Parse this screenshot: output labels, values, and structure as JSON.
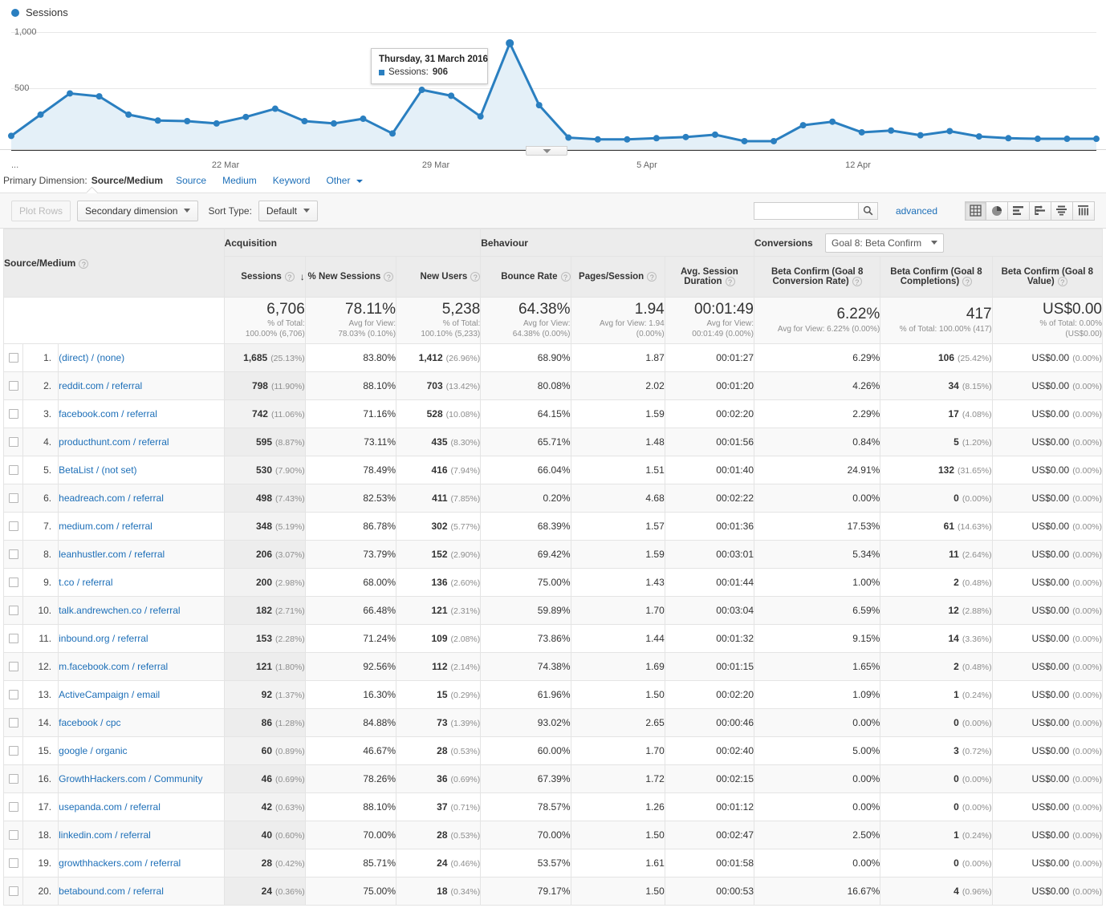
{
  "chart": {
    "legend_label": "Sessions",
    "y_ticks": [
      "1,000",
      "500"
    ],
    "x_ticks": [
      "22 Mar",
      "29 Mar",
      "5 Apr",
      "12 Apr"
    ],
    "x_leading_ellipsis": "...",
    "tooltip": {
      "date": "Thursday, 31 March 2016",
      "metric_label": "Sessions:",
      "metric_value": "906"
    },
    "line_color": "#2a7fc0",
    "fill_color": "#e4f0f8"
  },
  "chart_data": {
    "type": "line",
    "title": "Sessions",
    "xlabel": "",
    "ylabel": "Sessions",
    "ylim": [
      0,
      1000
    ],
    "grid": true,
    "legend": [
      "Sessions"
    ],
    "tick_labels_x": [
      "22 Mar",
      "29 Mar",
      "5 Apr",
      "12 Apr"
    ],
    "tick_labels_y": [
      "500",
      "1,000"
    ],
    "annotation": "Thursday, 31 March 2016 — Sessions: 906",
    "series": [
      {
        "name": "Sessions",
        "values": [
          120,
          300,
          480,
          455,
          300,
          250,
          245,
          225,
          280,
          350,
          245,
          225,
          265,
          140,
          510,
          460,
          285,
          906,
          380,
          105,
          90,
          90,
          100,
          110,
          130,
          75,
          75,
          210,
          240,
          150,
          165,
          125,
          160,
          115,
          100,
          95,
          95,
          95
        ]
      }
    ]
  },
  "primary_dimension": {
    "label": "Primary Dimension:",
    "current": "Source/Medium",
    "links": [
      "Source",
      "Medium",
      "Keyword"
    ],
    "other": "Other"
  },
  "toolbar": {
    "plot_rows": "Plot Rows",
    "secondary_dimension": "Secondary dimension",
    "sort_type_label": "Sort Type:",
    "sort_type_value": "Default",
    "search_value": "",
    "search_placeholder": "",
    "advanced": "advanced",
    "view_icons": [
      "table-view-icon",
      "pie-view-icon",
      "bar-view-icon",
      "comparison-view-icon",
      "pivot-view-icon",
      "performance-view-icon"
    ]
  },
  "table": {
    "groups": {
      "dimension": "Source/Medium",
      "acquisition": "Acquisition",
      "behaviour": "Behaviour",
      "conversions": "Conversions",
      "conversions_select": "Goal 8: Beta Confirm"
    },
    "columns": [
      "Sessions",
      "% New Sessions",
      "New Users",
      "Bounce Rate",
      "Pages/Session",
      "Avg. Session Duration",
      "Beta Confirm (Goal 8 Conversion Rate)",
      "Beta Confirm (Goal 8 Completions)",
      "Beta Confirm (Goal 8 Value)"
    ],
    "sort_column": "Sessions",
    "sort_direction": "desc",
    "totals": [
      {
        "big": "6,706",
        "sub1": "% of Total:",
        "sub2": "100.00% (6,706)"
      },
      {
        "big": "78.11%",
        "sub1": "Avg for View:",
        "sub2": "78.03% (0.10%)"
      },
      {
        "big": "5,238",
        "sub1": "% of Total:",
        "sub2": "100.10% (5,233)"
      },
      {
        "big": "64.38%",
        "sub1": "Avg for View:",
        "sub2": "64.38% (0.00%)"
      },
      {
        "big": "1.94",
        "sub1": "Avg for View: 1.94",
        "sub2": "(0.00%)"
      },
      {
        "big": "00:01:49",
        "sub1": "Avg for View:",
        "sub2": "00:01:49 (0.00%)"
      },
      {
        "big": "6.22%",
        "sub1": "Avg for View: 6.22% (0.00%)",
        "sub2": ""
      },
      {
        "big": "417",
        "sub1": "% of Total: 100.00% (417)",
        "sub2": ""
      },
      {
        "big": "US$0.00",
        "sub1": "% of Total: 0.00%",
        "sub2": "(US$0.00)"
      }
    ],
    "rows": [
      {
        "index": "1.",
        "source": "(direct) / (none)",
        "sessions": "1,685",
        "sessions_pct": "(25.13%)",
        "new_sessions_pct": "83.80%",
        "new_users": "1,412",
        "new_users_pct": "(26.96%)",
        "bounce_rate": "68.90%",
        "pages_session": "1.87",
        "avg_duration": "00:01:27",
        "goal_rate": "6.29%",
        "goal_completions": "106",
        "goal_completions_pct": "(25.42%)",
        "goal_value": "US$0.00",
        "goal_value_pct": "(0.00%)"
      },
      {
        "index": "2.",
        "source": "reddit.com / referral",
        "sessions": "798",
        "sessions_pct": "(11.90%)",
        "new_sessions_pct": "88.10%",
        "new_users": "703",
        "new_users_pct": "(13.42%)",
        "bounce_rate": "80.08%",
        "pages_session": "2.02",
        "avg_duration": "00:01:20",
        "goal_rate": "4.26%",
        "goal_completions": "34",
        "goal_completions_pct": "(8.15%)",
        "goal_value": "US$0.00",
        "goal_value_pct": "(0.00%)"
      },
      {
        "index": "3.",
        "source": "facebook.com / referral",
        "sessions": "742",
        "sessions_pct": "(11.06%)",
        "new_sessions_pct": "71.16%",
        "new_users": "528",
        "new_users_pct": "(10.08%)",
        "bounce_rate": "64.15%",
        "pages_session": "1.59",
        "avg_duration": "00:02:20",
        "goal_rate": "2.29%",
        "goal_completions": "17",
        "goal_completions_pct": "(4.08%)",
        "goal_value": "US$0.00",
        "goal_value_pct": "(0.00%)"
      },
      {
        "index": "4.",
        "source": "producthunt.com / referral",
        "sessions": "595",
        "sessions_pct": "(8.87%)",
        "new_sessions_pct": "73.11%",
        "new_users": "435",
        "new_users_pct": "(8.30%)",
        "bounce_rate": "65.71%",
        "pages_session": "1.48",
        "avg_duration": "00:01:56",
        "goal_rate": "0.84%",
        "goal_completions": "5",
        "goal_completions_pct": "(1.20%)",
        "goal_value": "US$0.00",
        "goal_value_pct": "(0.00%)"
      },
      {
        "index": "5.",
        "source": "BetaList / (not set)",
        "sessions": "530",
        "sessions_pct": "(7.90%)",
        "new_sessions_pct": "78.49%",
        "new_users": "416",
        "new_users_pct": "(7.94%)",
        "bounce_rate": "66.04%",
        "pages_session": "1.51",
        "avg_duration": "00:01:40",
        "goal_rate": "24.91%",
        "goal_completions": "132",
        "goal_completions_pct": "(31.65%)",
        "goal_value": "US$0.00",
        "goal_value_pct": "(0.00%)"
      },
      {
        "index": "6.",
        "source": "headreach.com / referral",
        "sessions": "498",
        "sessions_pct": "(7.43%)",
        "new_sessions_pct": "82.53%",
        "new_users": "411",
        "new_users_pct": "(7.85%)",
        "bounce_rate": "0.20%",
        "pages_session": "4.68",
        "avg_duration": "00:02:22",
        "goal_rate": "0.00%",
        "goal_completions": "0",
        "goal_completions_pct": "(0.00%)",
        "goal_value": "US$0.00",
        "goal_value_pct": "(0.00%)"
      },
      {
        "index": "7.",
        "source": "medium.com / referral",
        "sessions": "348",
        "sessions_pct": "(5.19%)",
        "new_sessions_pct": "86.78%",
        "new_users": "302",
        "new_users_pct": "(5.77%)",
        "bounce_rate": "68.39%",
        "pages_session": "1.57",
        "avg_duration": "00:01:36",
        "goal_rate": "17.53%",
        "goal_completions": "61",
        "goal_completions_pct": "(14.63%)",
        "goal_value": "US$0.00",
        "goal_value_pct": "(0.00%)"
      },
      {
        "index": "8.",
        "source": "leanhustler.com / referral",
        "sessions": "206",
        "sessions_pct": "(3.07%)",
        "new_sessions_pct": "73.79%",
        "new_users": "152",
        "new_users_pct": "(2.90%)",
        "bounce_rate": "69.42%",
        "pages_session": "1.59",
        "avg_duration": "00:03:01",
        "goal_rate": "5.34%",
        "goal_completions": "11",
        "goal_completions_pct": "(2.64%)",
        "goal_value": "US$0.00",
        "goal_value_pct": "(0.00%)"
      },
      {
        "index": "9.",
        "source": "t.co / referral",
        "sessions": "200",
        "sessions_pct": "(2.98%)",
        "new_sessions_pct": "68.00%",
        "new_users": "136",
        "new_users_pct": "(2.60%)",
        "bounce_rate": "75.00%",
        "pages_session": "1.43",
        "avg_duration": "00:01:44",
        "goal_rate": "1.00%",
        "goal_completions": "2",
        "goal_completions_pct": "(0.48%)",
        "goal_value": "US$0.00",
        "goal_value_pct": "(0.00%)"
      },
      {
        "index": "10.",
        "source": "talk.andrewchen.co / referral",
        "sessions": "182",
        "sessions_pct": "(2.71%)",
        "new_sessions_pct": "66.48%",
        "new_users": "121",
        "new_users_pct": "(2.31%)",
        "bounce_rate": "59.89%",
        "pages_session": "1.70",
        "avg_duration": "00:03:04",
        "goal_rate": "6.59%",
        "goal_completions": "12",
        "goal_completions_pct": "(2.88%)",
        "goal_value": "US$0.00",
        "goal_value_pct": "(0.00%)"
      },
      {
        "index": "11.",
        "source": "inbound.org / referral",
        "sessions": "153",
        "sessions_pct": "(2.28%)",
        "new_sessions_pct": "71.24%",
        "new_users": "109",
        "new_users_pct": "(2.08%)",
        "bounce_rate": "73.86%",
        "pages_session": "1.44",
        "avg_duration": "00:01:32",
        "goal_rate": "9.15%",
        "goal_completions": "14",
        "goal_completions_pct": "(3.36%)",
        "goal_value": "US$0.00",
        "goal_value_pct": "(0.00%)"
      },
      {
        "index": "12.",
        "source": "m.facebook.com / referral",
        "sessions": "121",
        "sessions_pct": "(1.80%)",
        "new_sessions_pct": "92.56%",
        "new_users": "112",
        "new_users_pct": "(2.14%)",
        "bounce_rate": "74.38%",
        "pages_session": "1.69",
        "avg_duration": "00:01:15",
        "goal_rate": "1.65%",
        "goal_completions": "2",
        "goal_completions_pct": "(0.48%)",
        "goal_value": "US$0.00",
        "goal_value_pct": "(0.00%)"
      },
      {
        "index": "13.",
        "source": "ActiveCampaign / email",
        "sessions": "92",
        "sessions_pct": "(1.37%)",
        "new_sessions_pct": "16.30%",
        "new_users": "15",
        "new_users_pct": "(0.29%)",
        "bounce_rate": "61.96%",
        "pages_session": "1.50",
        "avg_duration": "00:02:20",
        "goal_rate": "1.09%",
        "goal_completions": "1",
        "goal_completions_pct": "(0.24%)",
        "goal_value": "US$0.00",
        "goal_value_pct": "(0.00%)"
      },
      {
        "index": "14.",
        "source": "facebook / cpc",
        "sessions": "86",
        "sessions_pct": "(1.28%)",
        "new_sessions_pct": "84.88%",
        "new_users": "73",
        "new_users_pct": "(1.39%)",
        "bounce_rate": "93.02%",
        "pages_session": "2.65",
        "avg_duration": "00:00:46",
        "goal_rate": "0.00%",
        "goal_completions": "0",
        "goal_completions_pct": "(0.00%)",
        "goal_value": "US$0.00",
        "goal_value_pct": "(0.00%)"
      },
      {
        "index": "15.",
        "source": "google / organic",
        "sessions": "60",
        "sessions_pct": "(0.89%)",
        "new_sessions_pct": "46.67%",
        "new_users": "28",
        "new_users_pct": "(0.53%)",
        "bounce_rate": "60.00%",
        "pages_session": "1.70",
        "avg_duration": "00:02:40",
        "goal_rate": "5.00%",
        "goal_completions": "3",
        "goal_completions_pct": "(0.72%)",
        "goal_value": "US$0.00",
        "goal_value_pct": "(0.00%)"
      },
      {
        "index": "16.",
        "source": "GrowthHackers.com / Community",
        "sessions": "46",
        "sessions_pct": "(0.69%)",
        "new_sessions_pct": "78.26%",
        "new_users": "36",
        "new_users_pct": "(0.69%)",
        "bounce_rate": "67.39%",
        "pages_session": "1.72",
        "avg_duration": "00:02:15",
        "goal_rate": "0.00%",
        "goal_completions": "0",
        "goal_completions_pct": "(0.00%)",
        "goal_value": "US$0.00",
        "goal_value_pct": "(0.00%)"
      },
      {
        "index": "17.",
        "source": "usepanda.com / referral",
        "sessions": "42",
        "sessions_pct": "(0.63%)",
        "new_sessions_pct": "88.10%",
        "new_users": "37",
        "new_users_pct": "(0.71%)",
        "bounce_rate": "78.57%",
        "pages_session": "1.26",
        "avg_duration": "00:01:12",
        "goal_rate": "0.00%",
        "goal_completions": "0",
        "goal_completions_pct": "(0.00%)",
        "goal_value": "US$0.00",
        "goal_value_pct": "(0.00%)"
      },
      {
        "index": "18.",
        "source": "linkedin.com / referral",
        "sessions": "40",
        "sessions_pct": "(0.60%)",
        "new_sessions_pct": "70.00%",
        "new_users": "28",
        "new_users_pct": "(0.53%)",
        "bounce_rate": "70.00%",
        "pages_session": "1.50",
        "avg_duration": "00:02:47",
        "goal_rate": "2.50%",
        "goal_completions": "1",
        "goal_completions_pct": "(0.24%)",
        "goal_value": "US$0.00",
        "goal_value_pct": "(0.00%)"
      },
      {
        "index": "19.",
        "source": "growthhackers.com / referral",
        "sessions": "28",
        "sessions_pct": "(0.42%)",
        "new_sessions_pct": "85.71%",
        "new_users": "24",
        "new_users_pct": "(0.46%)",
        "bounce_rate": "53.57%",
        "pages_session": "1.61",
        "avg_duration": "00:01:58",
        "goal_rate": "0.00%",
        "goal_completions": "0",
        "goal_completions_pct": "(0.00%)",
        "goal_value": "US$0.00",
        "goal_value_pct": "(0.00%)"
      },
      {
        "index": "20.",
        "source": "betabound.com / referral",
        "sessions": "24",
        "sessions_pct": "(0.36%)",
        "new_sessions_pct": "75.00%",
        "new_users": "18",
        "new_users_pct": "(0.34%)",
        "bounce_rate": "79.17%",
        "pages_session": "1.50",
        "avg_duration": "00:00:53",
        "goal_rate": "16.67%",
        "goal_completions": "4",
        "goal_completions_pct": "(0.96%)",
        "goal_value": "US$0.00",
        "goal_value_pct": "(0.00%)"
      }
    ]
  }
}
